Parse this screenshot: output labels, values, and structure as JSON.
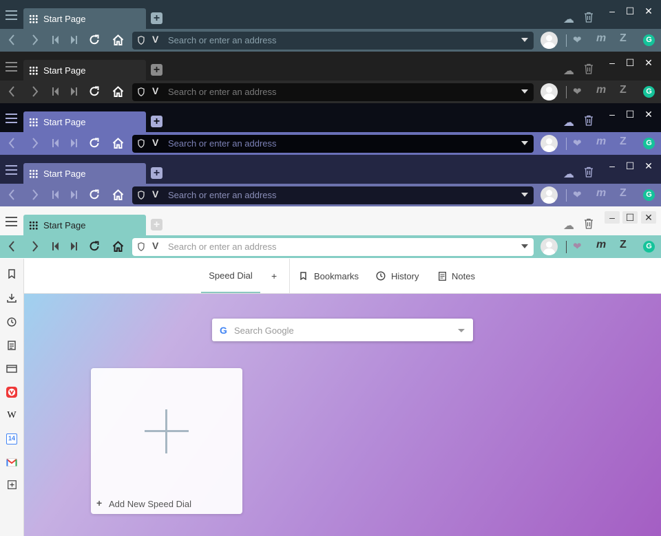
{
  "tab": {
    "title": "Start Page"
  },
  "address": {
    "placeholder": "Search or enter an address",
    "v_logo": "V"
  },
  "extensions": {
    "m_label": "m",
    "z_label": "Z",
    "g_label": "G"
  },
  "themes": [
    {
      "tabbar_bg": "#283741",
      "addr_bg": "#4f6672",
      "tab_bg": "#4f6672",
      "url_bg": "#283741",
      "fg": "#ffffff",
      "dim": "#9ab0bb",
      "ph": "#8aa0ab"
    },
    {
      "tabbar_bg": "#202020",
      "addr_bg": "#2b2b2b",
      "tab_bg": "#2b2b2b",
      "url_bg": "#0e0e0e",
      "fg": "#ffffff",
      "dim": "#8a8a8a",
      "ph": "#7a7a7a"
    },
    {
      "tabbar_bg": "#0b0d16",
      "addr_bg": "#6a70b8",
      "tab_bg": "#6a70b8",
      "url_bg": "#05060c",
      "fg": "#ffffff",
      "dim": "#a8acd8",
      "ph": "#7b80b5"
    },
    {
      "tabbar_bg": "#232643",
      "addr_bg": "#6d72ad",
      "tab_bg": "#6d72ad",
      "url_bg": "#141627",
      "fg": "#ffffff",
      "dim": "#a8acd6",
      "ph": "#8a8eb8"
    },
    {
      "tabbar_bg": "#f7f7f7",
      "addr_bg": "#86cec5",
      "tab_bg": "#86cec5",
      "url_bg": "#ffffff",
      "fg": "#222222",
      "dim": "#444444",
      "ph": "#9a9a9a"
    }
  ],
  "startpage": {
    "tabs": {
      "speed_dial": "Speed Dial",
      "add": "+",
      "bookmarks": "Bookmarks",
      "history": "History",
      "notes": "Notes"
    },
    "search": {
      "engine_logo": "G",
      "placeholder": "Search Google"
    },
    "add_dial_label": "Add New Speed Dial"
  },
  "sidebar": {
    "calendar_day": "14",
    "wiki_label": "W",
    "mail_label": "M"
  }
}
